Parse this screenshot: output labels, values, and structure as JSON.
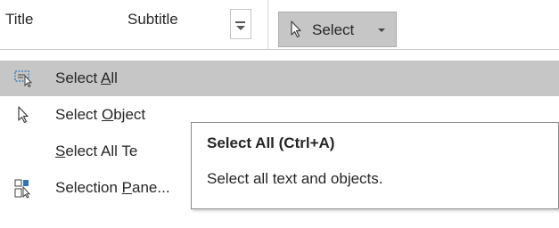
{
  "ribbon": {
    "styles": [
      "Title",
      "Subtitle"
    ],
    "select_button": {
      "label": "Select",
      "icon": "cursor-arrow-icon"
    }
  },
  "menu": {
    "items": [
      {
        "before": "Select ",
        "key": "A",
        "after": "ll",
        "icon": "select-all-icon",
        "highlighted": true
      },
      {
        "before": "Select ",
        "key": "O",
        "after": "bject",
        "icon": "cursor-arrow-icon",
        "highlighted": false
      },
      {
        "before": "",
        "key": "S",
        "after": "elect All Te",
        "icon": "",
        "highlighted": false
      },
      {
        "before": "Selection ",
        "key": "P",
        "after": "ane...",
        "icon": "selection-pane-icon",
        "highlighted": false
      }
    ]
  },
  "tooltip": {
    "title": "Select All (Ctrl+A)",
    "description": "Select all text and objects."
  },
  "colors": {
    "highlight": "#c6c6c6",
    "text": "#262626",
    "icon_blue": "#2e75b6"
  }
}
